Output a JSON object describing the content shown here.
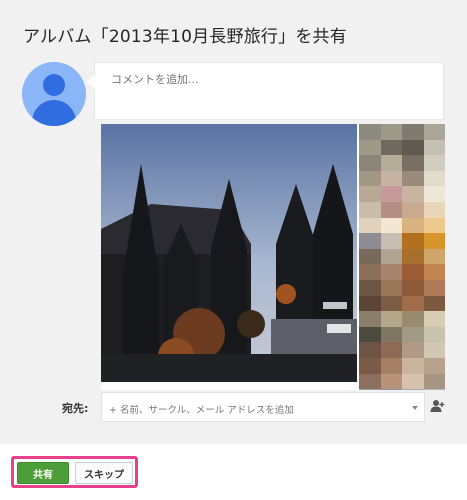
{
  "dialog": {
    "title": "アルバム「2013年10月長野旅行」を共有"
  },
  "compose": {
    "placeholder": "コメントを追加..."
  },
  "recipients": {
    "label": "宛先:",
    "placeholder": "+ 名前、サークル、メール アドレスを追加"
  },
  "buttons": {
    "share": "共有",
    "skip": "スキップ"
  },
  "colors": {
    "share_green": "#4d9d38",
    "highlight_pink": "#e8408a",
    "avatar_blue": "#2f6de0"
  },
  "icons": {
    "avatar": "person-silhouette",
    "add_person": "person-add-icon",
    "dropdown": "chevron-down-icon"
  }
}
